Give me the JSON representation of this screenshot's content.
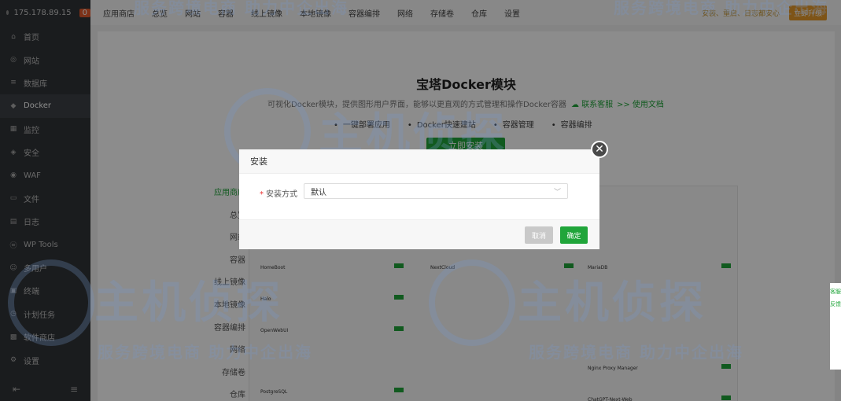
{
  "sidebar": {
    "ip": "175.178.89.15",
    "badge": "0",
    "items": [
      {
        "label": "首页",
        "icon": "home-icon",
        "glyph": "⌂"
      },
      {
        "label": "网站",
        "icon": "globe-icon",
        "glyph": "◎"
      },
      {
        "label": "数据库",
        "icon": "database-icon",
        "glyph": "≡"
      },
      {
        "label": "Docker",
        "icon": "docker-icon",
        "glyph": "◆"
      },
      {
        "label": "监控",
        "icon": "monitor-icon",
        "glyph": "▦"
      },
      {
        "label": "安全",
        "icon": "shield-icon",
        "glyph": "◈"
      },
      {
        "label": "WAF",
        "icon": "waf-icon",
        "glyph": "◉"
      },
      {
        "label": "文件",
        "icon": "folder-icon",
        "glyph": "▭"
      },
      {
        "label": "日志",
        "icon": "log-icon",
        "glyph": "▤"
      },
      {
        "label": "WP Tools",
        "icon": "wordpress-icon",
        "glyph": "ⓦ"
      },
      {
        "label": "多用户",
        "icon": "users-icon",
        "glyph": "☺"
      },
      {
        "label": "终端",
        "icon": "terminal-icon",
        "glyph": "▣"
      },
      {
        "label": "计划任务",
        "icon": "clock-icon",
        "glyph": "◷"
      },
      {
        "label": "软件商店",
        "icon": "store-icon",
        "glyph": "▩"
      },
      {
        "label": "设置",
        "icon": "gear-icon",
        "glyph": "⚙"
      }
    ]
  },
  "topnav": {
    "items": [
      "应用商店",
      "总览",
      "网站",
      "容器",
      "线上镜像",
      "本地镜像",
      "容器编排",
      "网络",
      "存储卷",
      "仓库",
      "设置"
    ],
    "warning": "安装、重启、日志都安心",
    "upgrade": "立即升级"
  },
  "main": {
    "title": "宝塔Docker模块",
    "description": "可视化Docker模块，提供图形用户界面，能够以更直观的方式管理和操作Docker容器",
    "link_support": "联系客服",
    "link_docs": ">> 使用文档",
    "features": [
      "一键部署应用",
      "Docker快速建站",
      "容器管理",
      "容器编排"
    ],
    "install_label": "立即安装",
    "subnav": [
      "应用商店",
      "总览",
      "网站",
      "容器",
      "线上镜像",
      "本地镜像",
      "容器编排",
      "网络",
      "存储卷",
      "仓库"
    ],
    "preview_cards": [
      "HomeBoot",
      "NextCloud",
      "MariaDB",
      "Halo",
      "OpenWebUI",
      "Nginx Proxy Manager",
      "PostgreSQL",
      "ChatGPT-Next-Web"
    ]
  },
  "watermark": {
    "big": "主机侦探",
    "small": "服务跨境电商 助力中企出海"
  },
  "modal": {
    "title": "安装",
    "field_label": "安装方式",
    "required_mark": "*",
    "select_value": "默认",
    "cancel": "取消",
    "confirm": "确定"
  },
  "right_tools": [
    "客服",
    "反馈"
  ]
}
